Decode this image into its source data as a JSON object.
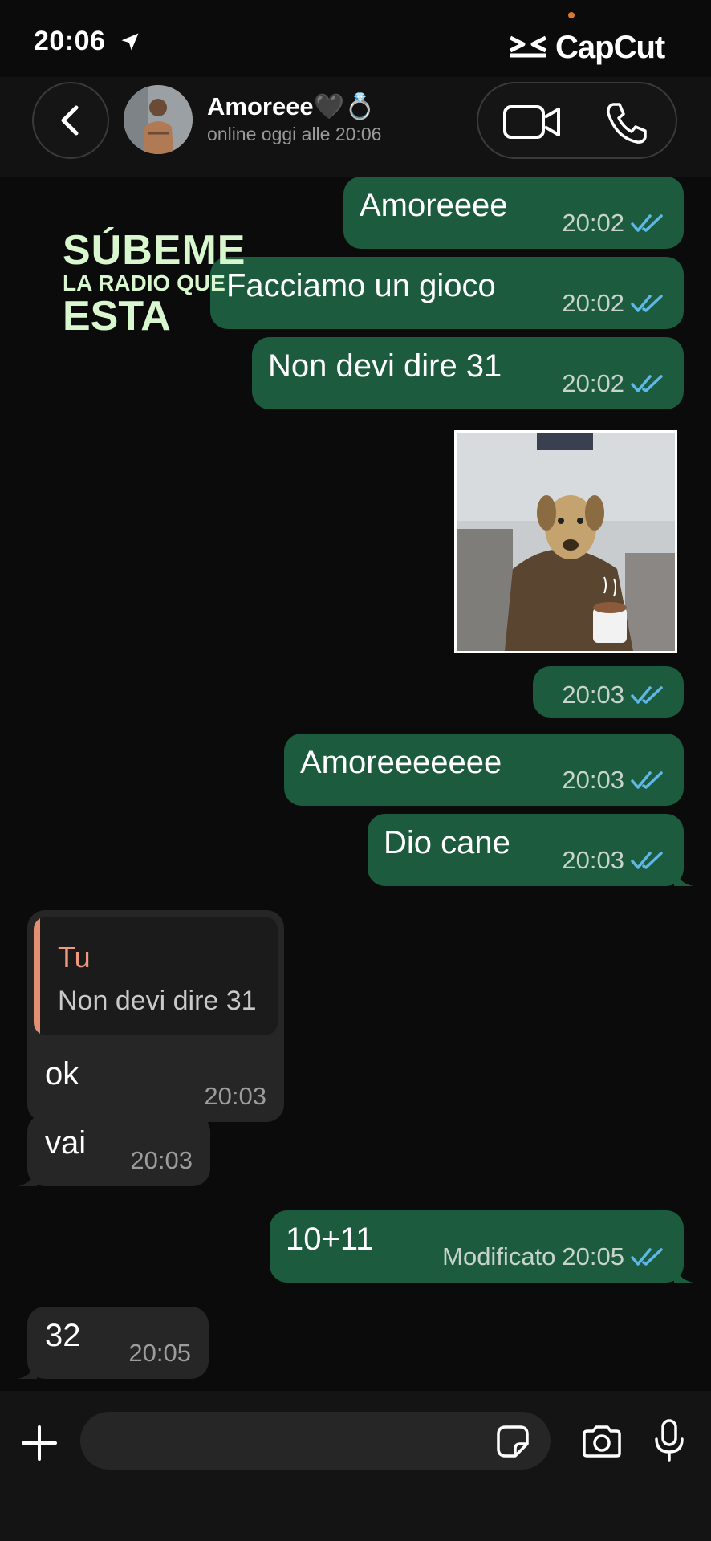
{
  "status_bar": {
    "time": "20:06",
    "overlay_app": "CapCut"
  },
  "header": {
    "contact_name": "Amoreee🖤💍",
    "contact_status": "online oggi alle 20:06"
  },
  "overlay_text": {
    "line1": "SÚBEME",
    "line2": "LA RADIO QUE",
    "line3": "ESTA"
  },
  "messages": [
    {
      "dir": "out",
      "text": "Amoreeee",
      "time": "20:02",
      "status": "read"
    },
    {
      "dir": "out",
      "text": "Facciamo un gioco",
      "time": "20:02",
      "status": "read"
    },
    {
      "dir": "out",
      "text": "Non devi dire 31",
      "time": "20:02",
      "status": "read"
    },
    {
      "dir": "out",
      "type": "image",
      "time": "20:03",
      "status": "read"
    },
    {
      "dir": "out",
      "text": "Amoreeeeeee",
      "time": "20:03",
      "status": "read"
    },
    {
      "dir": "out",
      "text": "Dio cane",
      "time": "20:03",
      "status": "read"
    },
    {
      "dir": "in",
      "reply_to": {
        "author": "Tu",
        "text": "Non devi dire 31"
      },
      "text": "ok",
      "time": "20:03"
    },
    {
      "dir": "in",
      "text": "vai",
      "time": "20:03"
    },
    {
      "dir": "out",
      "text": "10+11",
      "edited_label": "Modificato",
      "time": "20:05",
      "status": "read"
    },
    {
      "dir": "in",
      "text": "32",
      "time": "20:05"
    }
  ],
  "input_bar": {
    "placeholder": ""
  },
  "colors": {
    "outgoing_bubble": "#1c5b3d",
    "incoming_bubble": "#262626",
    "read_ticks": "#5fb7e6",
    "quote_accent": "#e58f72"
  }
}
